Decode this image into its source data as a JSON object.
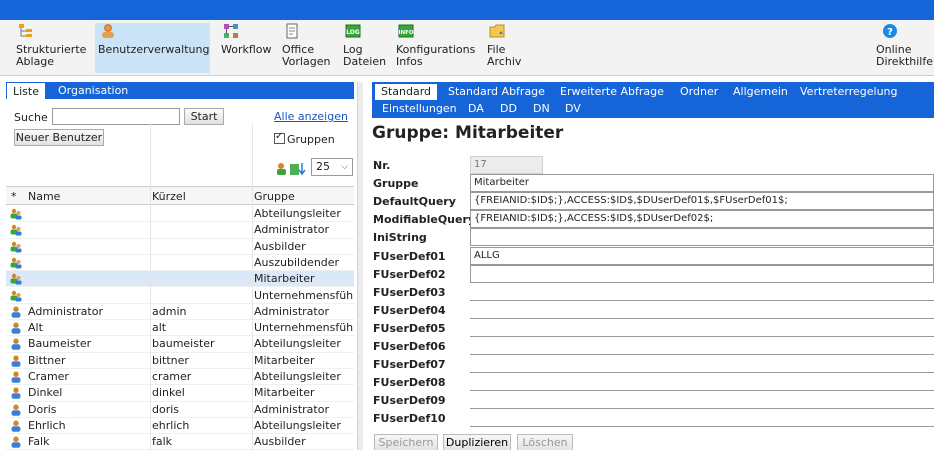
{
  "toolbar": {
    "items": [
      {
        "label": "Strukturierte\nAblage",
        "icon": "structure-icon"
      },
      {
        "label": "Benutzerverwaltung",
        "icon": "user-admin-icon"
      },
      {
        "label": "Workflow",
        "icon": "workflow-icon"
      },
      {
        "label": "Office\nVorlagen",
        "icon": "document-icon"
      },
      {
        "label": "Log\nDateien",
        "icon": "log-icon",
        "badge": "LOG"
      },
      {
        "label": "Konfigurations\nInfos",
        "icon": "info-icon",
        "badge": "INFO"
      },
      {
        "label": "File\nArchiv",
        "icon": "folder-icon"
      },
      {
        "label": "Online\nDirekthilfe",
        "icon": "help-icon",
        "glyph": "?"
      }
    ]
  },
  "left": {
    "tabs": [
      "Liste",
      "Organisation"
    ],
    "search_label": "Suche",
    "search_value": "",
    "start_button": "Start",
    "show_all_link": "Alle anzeigen",
    "new_user_button": "Neuer Benutzer",
    "groups_checkbox": "Gruppen",
    "page_size": "25",
    "columns": {
      "star": "*",
      "name": "Name",
      "kurzel": "Kürzel",
      "gruppe": "Gruppe"
    },
    "rows": [
      {
        "type": "group",
        "name": "",
        "kurzel": "",
        "gruppe": "Abteilungsleiter"
      },
      {
        "type": "group",
        "name": "",
        "kurzel": "",
        "gruppe": "Administrator"
      },
      {
        "type": "group",
        "name": "",
        "kurzel": "",
        "gruppe": "Ausbilder"
      },
      {
        "type": "group",
        "name": "",
        "kurzel": "",
        "gruppe": "Auszubildender"
      },
      {
        "type": "group",
        "name": "",
        "kurzel": "",
        "gruppe": "Mitarbeiter",
        "selected": true
      },
      {
        "type": "group",
        "name": "",
        "kurzel": "",
        "gruppe": "Unternehmensführ"
      },
      {
        "type": "user",
        "name": "Administrator",
        "kurzel": "admin",
        "gruppe": "Administrator"
      },
      {
        "type": "user",
        "name": "Alt",
        "kurzel": "alt",
        "gruppe": "Unternehmensführ"
      },
      {
        "type": "user",
        "name": "Baumeister",
        "kurzel": "baumeister",
        "gruppe": "Abteilungsleiter"
      },
      {
        "type": "user",
        "name": "Bittner",
        "kurzel": "bittner",
        "gruppe": "Mitarbeiter"
      },
      {
        "type": "user",
        "name": "Cramer",
        "kurzel": "cramer",
        "gruppe": "Abteilungsleiter"
      },
      {
        "type": "user",
        "name": "Dinkel",
        "kurzel": "dinkel",
        "gruppe": "Mitarbeiter"
      },
      {
        "type": "user",
        "name": "Doris",
        "kurzel": "doris",
        "gruppe": "Administrator"
      },
      {
        "type": "user",
        "name": "Ehrlich",
        "kurzel": "ehrlich",
        "gruppe": "Abteilungsleiter"
      },
      {
        "type": "user",
        "name": "Falk",
        "kurzel": "falk",
        "gruppe": "Ausbilder"
      }
    ]
  },
  "right": {
    "tabs_row1": [
      "Standard",
      "Standard Abfrage",
      "Erweiterte Abfrage",
      "Ordner",
      "Allgemein",
      "Vertreterregelung"
    ],
    "tabs_row2": [
      "Einstellungen",
      "DA",
      "DD",
      "DN",
      "DV"
    ],
    "title": "Gruppe: Mitarbeiter",
    "fields": [
      {
        "label": "Nr.",
        "value": "17",
        "readonly": true
      },
      {
        "label": "Gruppe",
        "value": "Mitarbeiter"
      },
      {
        "label": "DefaultQuery",
        "value": "{FREIANID:$ID$;},ACCESS:$ID$,$DUserDef01$,$FUserDef01$;"
      },
      {
        "label": "ModifiableQuery",
        "value": "{FREIANID:$ID$;},ACCESS:$ID$,$DUserDef02$;"
      },
      {
        "label": "IniString",
        "value": ""
      },
      {
        "label": "FUserDef01",
        "value": "ALLG"
      },
      {
        "label": "FUserDef02",
        "value": ""
      },
      {
        "label": "FUserDef03",
        "value": ""
      },
      {
        "label": "FUserDef04",
        "value": ""
      },
      {
        "label": "FUserDef05",
        "value": ""
      },
      {
        "label": "FUserDef06",
        "value": ""
      },
      {
        "label": "FUserDef07",
        "value": ""
      },
      {
        "label": "FUserDef08",
        "value": ""
      },
      {
        "label": "FUserDef09",
        "value": ""
      },
      {
        "label": "FUserDef10",
        "value": ""
      }
    ],
    "buttons": {
      "save": "Speichern",
      "duplicate": "Duplizieren",
      "delete": "Löschen"
    }
  },
  "colors": {
    "accent": "#1565d8",
    "selected_row": "#dbe8f7",
    "toolbar_active": "#cbe3f7"
  }
}
